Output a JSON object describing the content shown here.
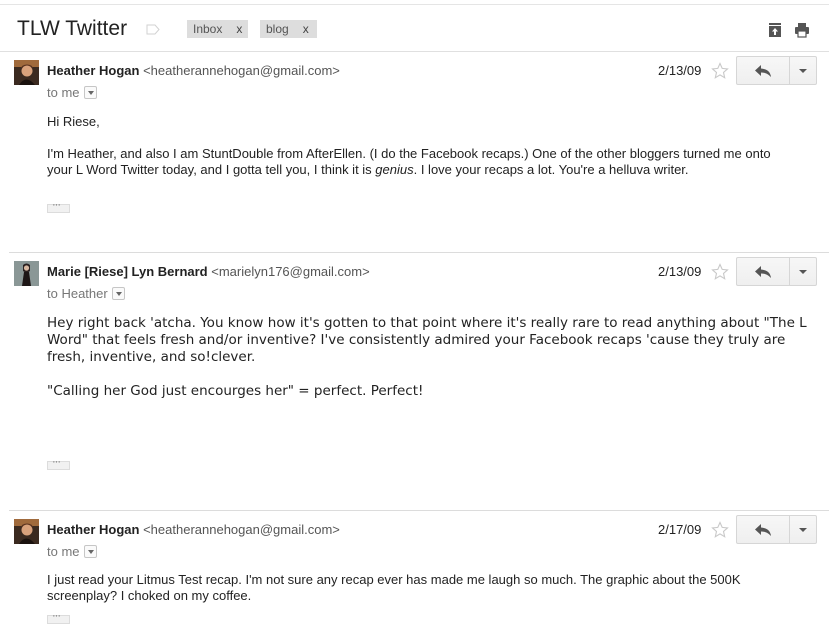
{
  "thread": {
    "subject": "TLW Twitter",
    "labels": [
      {
        "name": "Inbox",
        "remove": "x"
      },
      {
        "name": "blog",
        "remove": "x"
      }
    ]
  },
  "messages": [
    {
      "sender_name": "Heather Hogan",
      "sender_email": "<heatherannehogan@gmail.com>",
      "recipient": "to me",
      "date": "2/13/09",
      "greeting": "Hi Riese,",
      "paragraph_before_em": "I'm Heather, and also I am StuntDouble from AfterEllen. (I do the Facebook recaps.) One of the other bloggers turned me onto your L Word Twitter today, and I gotta tell you, I think it is ",
      "emphasis": "genius",
      "paragraph_after_em": ". I love your recaps a lot. You're a helluva writer."
    },
    {
      "sender_name": "Marie [Riese] Lyn Bernard",
      "sender_email": "<marielyn176@gmail.com>",
      "recipient": "to Heather",
      "date": "2/13/09",
      "paragraph1": "Hey right back 'atcha. You know how it's gotten to that point where it's really rare to read anything about \"The L Word\" that feels fresh and/or inventive?  I've consistently admired your Facebook recaps 'cause they truly are fresh, inventive, and so!clever.",
      "paragraph2": "\"Calling her God just encourges her\" = perfect. Perfect!"
    },
    {
      "sender_name": "Heather Hogan",
      "sender_email": "<heatherannehogan@gmail.com>",
      "recipient": "to me",
      "date": "2/17/09",
      "paragraph1": "I just read your Litmus Test recap. I'm not sure any recap ever has made me laugh so much. The graphic about the 500K screenplay? I choked on my coffee."
    }
  ],
  "icons": {
    "archive": "archive-icon",
    "print": "print-icon",
    "star": "star-icon",
    "reply": "reply-arrow-icon",
    "more": "chevron-down-icon"
  }
}
